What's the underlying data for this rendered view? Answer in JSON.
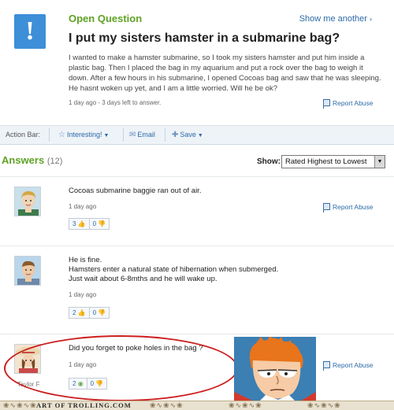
{
  "question": {
    "type_label": "Open Question",
    "show_another": "Show me another",
    "title": "I put my sisters hamster in a submarine bag?",
    "body": "I wanted to make a hamster submarine, so I took my sisters hamster and put him inside a plastic bag. Then I placed the bag in my aquarium and put a rock over the bag to weigh it down. After a few hours in his submarine, I opened Cocoas bag and saw that he was sleeping. He hasnt woken up yet, and I am a little worried. Will he be ok?",
    "meta": "1 day ago - 3 days left to answer.",
    "report": "Report Abuse",
    "icon": "question-mark-icon"
  },
  "action_bar": {
    "label": "Action Bar:",
    "interesting": "Interesting!",
    "email": "Email",
    "save": "Save"
  },
  "answers": {
    "title": "Answers",
    "count": "(12)",
    "show_label": "Show:",
    "sort_selected": "Rated Highest to Lowest",
    "items": [
      {
        "text": "Cocoas submarine baggie ran out of air.",
        "age": "1 day ago",
        "report": "Report Abuse",
        "thumbs_up": "3",
        "thumbs_down": "0"
      },
      {
        "text_lines": [
          "He is fine.",
          "Hamsters enter a natural state of hibernation when submerged.",
          "Just wait about 6-8mths and he will wake up."
        ],
        "age": "1 day ago",
        "thumbs_up": "2",
        "thumbs_down": "0"
      },
      {
        "text": "Did you forget to poke holes in the bag ?",
        "age": "1 day ago",
        "report": "Report Abuse",
        "thumbs_up": "2",
        "thumbs_down": "0",
        "username": "Taylor F"
      }
    ]
  },
  "footer": {
    "brand": "ART OF TROLLING.COM",
    "ornament": "❀∿❀∿❀"
  },
  "colors": {
    "accent_green": "#5ea224",
    "link_blue": "#2d6aa8",
    "highlight_red": "#cc1f1f"
  }
}
